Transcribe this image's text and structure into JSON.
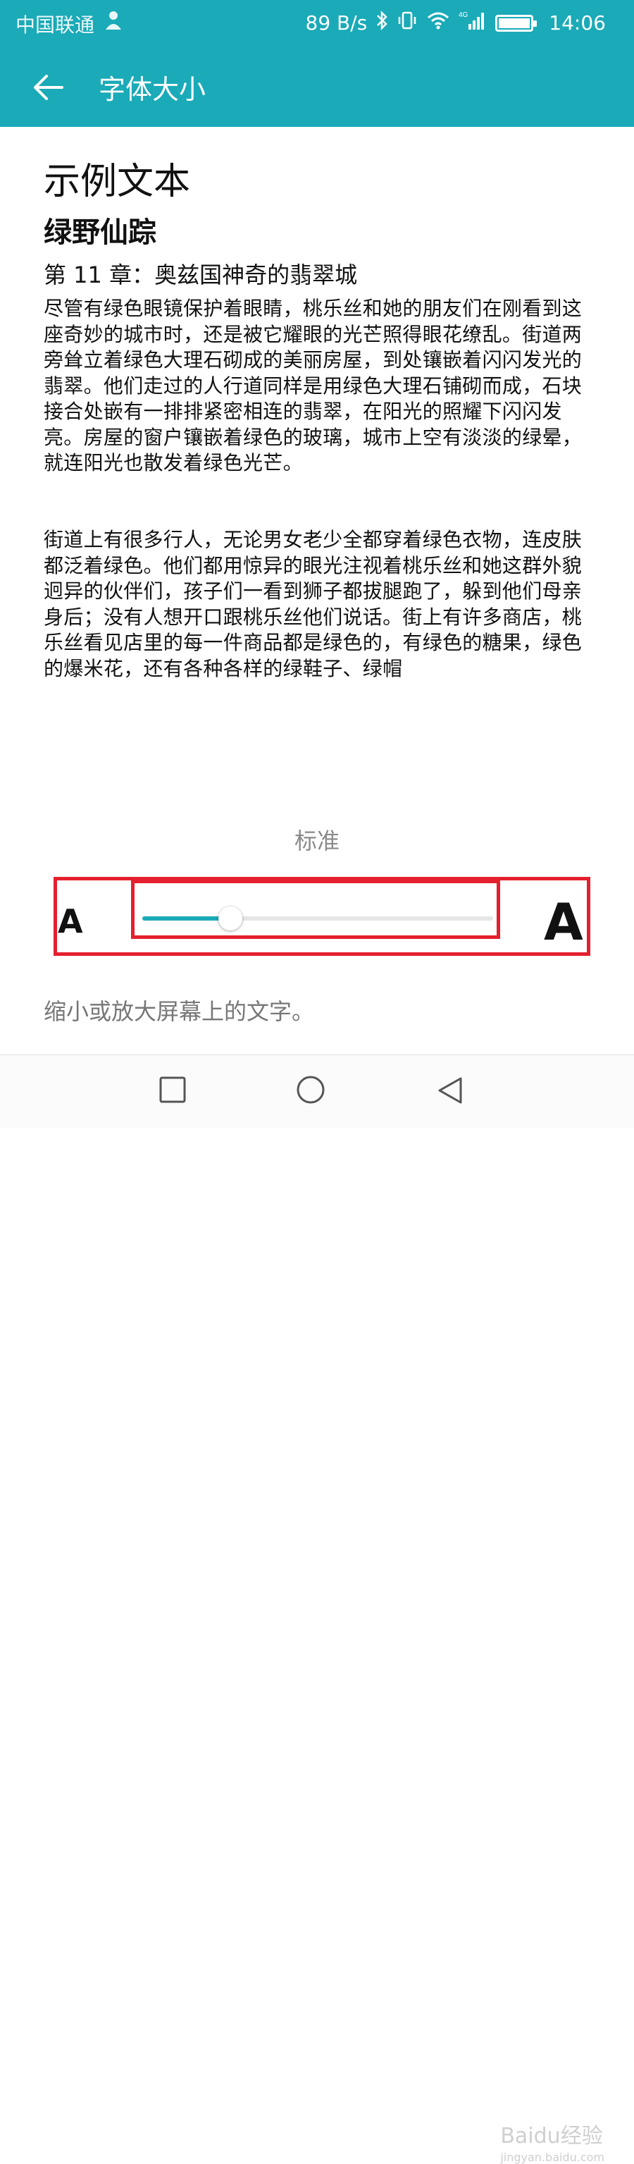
{
  "status_bar": {
    "carrier": "中国联通",
    "speed": "89 B/s",
    "network": "4G",
    "time": "14:06",
    "icons": [
      "person-icon",
      "bluetooth-icon",
      "vibrate-icon",
      "wifi-icon",
      "signal-icon",
      "battery-icon"
    ]
  },
  "app_bar": {
    "back_icon": "back-arrow-icon",
    "title": "字体大小"
  },
  "preview": {
    "heading": "示例文本",
    "book_title": "绿野仙踪",
    "chapter": "第 11 章：奥兹国神奇的翡翠城",
    "paragraph1": "尽管有绿色眼镜保护着眼睛，桃乐丝和她的朋友们在刚看到这座奇妙的城市时，还是被它耀眼的光芒照得眼花缭乱。街道两旁耸立着绿色大理石砌成的美丽房屋，到处镶嵌着闪闪发光的翡翠。他们走过的人行道同样是用绿色大理石铺砌而成，石块接合处嵌有一排排紧密相连的翡翠，在阳光的照耀下闪闪发亮。房屋的窗户镶嵌着绿色的玻璃，城市上空有淡淡的绿晕，就连阳光也散发着绿色光芒。",
    "paragraph2": "街道上有很多行人，无论男女老少全都穿着绿色衣物，连皮肤都泛着绿色。他们都用惊异的眼光注视着桃乐丝和她这群外貌迥异的伙伴们，孩子们一看到狮子都拔腿跑了，躲到他们母亲身后；没有人想开口跟桃乐丝他们说话。街上有许多商店，桃乐丝看见店里的每一件商品都是绿色的，有绿色的糖果，绿色的爆米花，还有各种各样的绿鞋子、绿帽"
  },
  "font_size": {
    "label": "标准",
    "small_glyph": "A",
    "large_glyph": "A",
    "level": 0.25
  },
  "hint": "缩小或放大屏幕上的文字。",
  "nav": {
    "icons": [
      "recent-apps-icon",
      "home-icon",
      "back-icon"
    ]
  },
  "watermark": {
    "brand": "Baidu经验",
    "url": "jingyan.baidu.com"
  },
  "colors": {
    "accent": "#1aaab8",
    "highlight_box": "#e4202e"
  }
}
